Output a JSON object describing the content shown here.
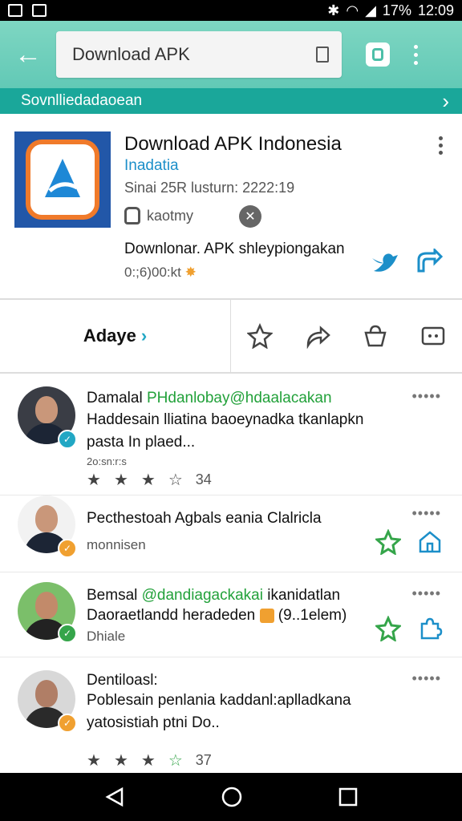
{
  "status_bar": {
    "battery_text": "17%",
    "time": "12:09"
  },
  "toolbar": {
    "url_text": "Download APK"
  },
  "subbar": {
    "text": "Sovnlliedadaoean"
  },
  "app": {
    "title": "Download APK Indonesia",
    "developer": "Inadatia",
    "meta": "Sinai 25R lusturn: 2222:19",
    "category": "kaotmy",
    "description": "Downlonar. APK shleypiongakan",
    "size": "0:;6)00:kt"
  },
  "actions": {
    "primary_label": "Adaye"
  },
  "reviews": [
    {
      "name": "Damalal",
      "handle": "PHdanlobay@hdaalacakan",
      "text_lines": [
        "Haddesain lliatina baoeynadka tkanlapkn",
        "pasta In plaed..."
      ],
      "sub": "2o:sn:r:s",
      "rating_text": "34"
    },
    {
      "name": "Pecthestoah Agbals eania Clalricla",
      "sub": "monnisen"
    },
    {
      "name": "Bemsal",
      "handle": "@dandiagackakai",
      "name_tail": "ikanidatlan",
      "text_lines": [
        "Daoraetlandd heradeden ",
        "(9..1elem)"
      ],
      "sub": "Dhiale"
    },
    {
      "name": "Dentiloasl:",
      "text_lines": [
        "Poblesain penlania kaddanl:aplladkana",
        "yatosistiah ptni Do.."
      ],
      "rating_text": "37"
    }
  ],
  "colors": {
    "toolbar": "#6dcfbb",
    "subbar": "#1aa79a",
    "accent_blue": "#1c8fc9",
    "green": "#35a54a",
    "orange": "#f07a2a"
  }
}
